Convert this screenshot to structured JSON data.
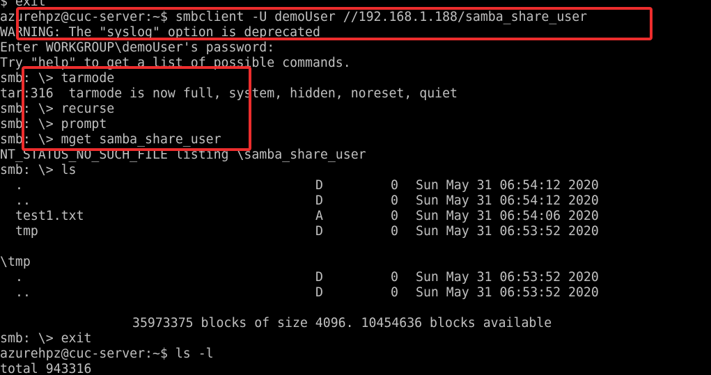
{
  "window": {
    "background": "#000000",
    "text_color": "#c0c0c0",
    "annotation_color": "#ec2d2d"
  },
  "terminal": {
    "lines": [
      "$ exit",
      "azurehpz@cuc-server:~$ smbclient -U demoUser //192.168.1.188/samba_share_user",
      "WARNING: The \"syslog\" option is deprecated",
      "Enter WORKGROUP\\demoUser's password:",
      "Try \"help\" to get a list of possible commands.",
      "smb: \\> tarmode",
      "tar:316  tarmode is now full, system, hidden, noreset, quiet",
      "smb: \\> recurse",
      "smb: \\> prompt",
      "smb: \\> mget samba_share_user",
      "NT_STATUS_NO_SUCH_FILE listing \\samba_share_user",
      "smb: \\> ls"
    ],
    "listing_root": [
      {
        "name": ".",
        "attr": "D",
        "size": "0",
        "date": "Sun May 31 06:54:12 2020"
      },
      {
        "name": "..",
        "attr": "D",
        "size": "0",
        "date": "Sun May 31 06:54:12 2020"
      },
      {
        "name": "test1.txt",
        "attr": "A",
        "size": "0",
        "date": "Sun May 31 06:54:06 2020"
      },
      {
        "name": "tmp",
        "attr": "D",
        "size": "0",
        "date": "Sun May 31 06:53:52 2020"
      }
    ],
    "tmp_header": "\\tmp",
    "listing_tmp": [
      {
        "name": ".",
        "attr": "D",
        "size": "0",
        "date": "Sun May 31 06:53:52 2020"
      },
      {
        "name": "..",
        "attr": "D",
        "size": "0",
        "date": "Sun May 31 06:53:52 2020"
      }
    ],
    "blocks_summary": "35973375 blocks of size 4096. 10454636 blocks available",
    "trailing_lines": [
      "smb: \\> exit",
      "azurehpz@cuc-server:~$ ls -l",
      "total 943316"
    ]
  }
}
